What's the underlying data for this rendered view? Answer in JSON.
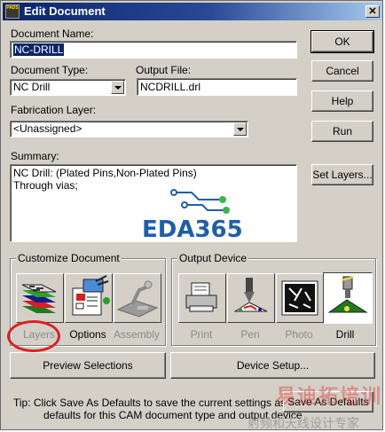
{
  "window": {
    "title": "Edit Document",
    "app_icon_text": "PADS"
  },
  "labels": {
    "document_name": "Document Name:",
    "document_type": "Document Type:",
    "output_file": "Output File:",
    "fabrication_layer": "Fabrication Layer:",
    "summary": "Summary:"
  },
  "fields": {
    "document_name": "NC-DRILL",
    "document_type": "NC Drill",
    "output_file": "NCDRILL.drl",
    "fabrication_layer": "<Unassigned>"
  },
  "summary": {
    "line1": "NC Drill: (Plated Pins,Non-Plated Pins)",
    "line2": "Through vias;"
  },
  "buttons": {
    "ok": "OK",
    "cancel": "Cancel",
    "help": "Help",
    "run": "Run",
    "set_layers": "Set Layers...",
    "preview": "Preview Selections",
    "device_setup": "Device Setup...",
    "save_defaults": "Save As Defaults"
  },
  "customize": {
    "title": "Customize Document",
    "items": [
      {
        "label": "Layers",
        "enabled": false
      },
      {
        "label": "Options",
        "enabled": true
      },
      {
        "label": "Assembly",
        "enabled": false
      }
    ]
  },
  "output_device": {
    "title": "Output Device",
    "items": [
      {
        "label": "Print",
        "enabled": false
      },
      {
        "label": "Pen",
        "enabled": false
      },
      {
        "label": "Photo",
        "enabled": false
      },
      {
        "label": "Drill",
        "enabled": true,
        "selected": true
      }
    ]
  },
  "tip": {
    "line1": "Tip: Click Save As Defaults to save the current settings as the",
    "line2": "defaults for this CAM document type and output device"
  },
  "watermark": {
    "logo_text": "EDA365",
    "cn_title": "易迪拓培训",
    "cn_sub": "射频和天线设计专家"
  },
  "colors": {
    "title_bar": "#0a246a",
    "highlight_circle": "#e02020",
    "logo_blue": "#1f5fa8"
  }
}
